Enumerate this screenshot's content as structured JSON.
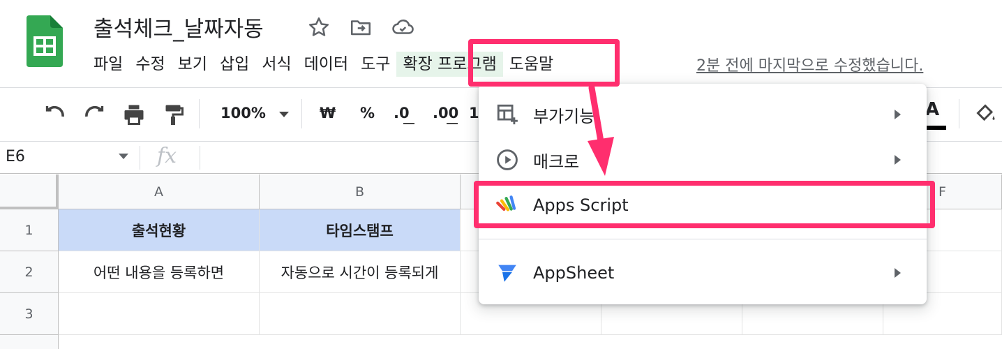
{
  "app": {
    "title": "출석체크_날짜자동",
    "last_edit": "2분 전에 마지막으로 수정했습니다.",
    "accent": "#188038"
  },
  "menu": {
    "items": [
      "파일",
      "수정",
      "보기",
      "삽입",
      "서식",
      "데이터",
      "도구",
      "확장 프로그램",
      "도움말"
    ],
    "active": "확장 프로그램"
  },
  "toolbar": {
    "zoom": "100%",
    "currency": "₩",
    "percent": "%",
    "dec_less": ".0",
    "dec_more": ".00",
    "more_formats": "1"
  },
  "formula_bar": {
    "cell_ref": "E6",
    "fx": "fx"
  },
  "grid": {
    "columns": [
      "A",
      "B",
      "",
      "",
      "",
      "F"
    ],
    "rows": [
      {
        "num": "1",
        "cells": [
          "출석현황",
          "타임스탬프"
        ]
      },
      {
        "num": "2",
        "cells": [
          "어떤 내용을 등록하면",
          "자동으로 시간이 등록되게"
        ]
      },
      {
        "num": "3",
        "cells": [
          "",
          ""
        ]
      }
    ]
  },
  "dropdown": {
    "items": [
      {
        "label": "부가기능",
        "icon": "add-on-icon",
        "submenu": true
      },
      {
        "label": "매크로",
        "icon": "play-circle-icon",
        "submenu": true
      },
      {
        "label": "Apps Script",
        "icon": "apps-script-icon",
        "submenu": false
      },
      {
        "label": "AppSheet",
        "icon": "appsheet-icon",
        "submenu": true
      }
    ]
  },
  "colors": {
    "highlight": "#ff2e6e",
    "header_fill": "#c9daf8",
    "menu_active": "#e6f4ea"
  }
}
